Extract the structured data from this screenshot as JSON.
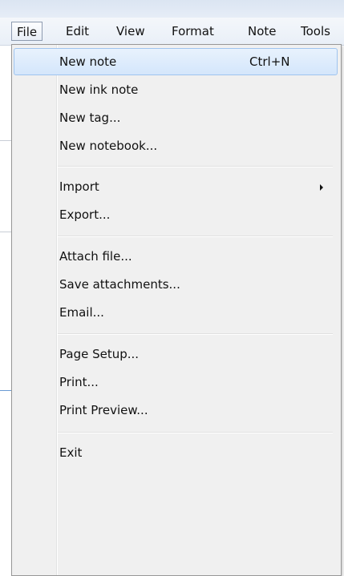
{
  "menubar": {
    "items": [
      {
        "label": "File",
        "active": true
      },
      {
        "label": "Edit"
      },
      {
        "label": "View"
      },
      {
        "label": "Format"
      },
      {
        "label": "Note"
      },
      {
        "label": "Tools"
      }
    ]
  },
  "file_menu": {
    "groups": [
      [
        {
          "label": "New note",
          "shortcut": "Ctrl+N",
          "highlighted": true
        },
        {
          "label": "New ink note"
        },
        {
          "label": "New tag..."
        },
        {
          "label": "New notebook..."
        }
      ],
      [
        {
          "label": "Import",
          "has_submenu": true
        },
        {
          "label": "Export..."
        }
      ],
      [
        {
          "label": "Attach file..."
        },
        {
          "label": "Save attachments..."
        },
        {
          "label": "Email..."
        }
      ],
      [
        {
          "label": "Page Setup..."
        },
        {
          "label": "Print..."
        },
        {
          "label": "Print Preview..."
        }
      ],
      [
        {
          "label": "Exit"
        }
      ]
    ],
    "submenu_arrow_icon": "triangle-right-icon"
  }
}
